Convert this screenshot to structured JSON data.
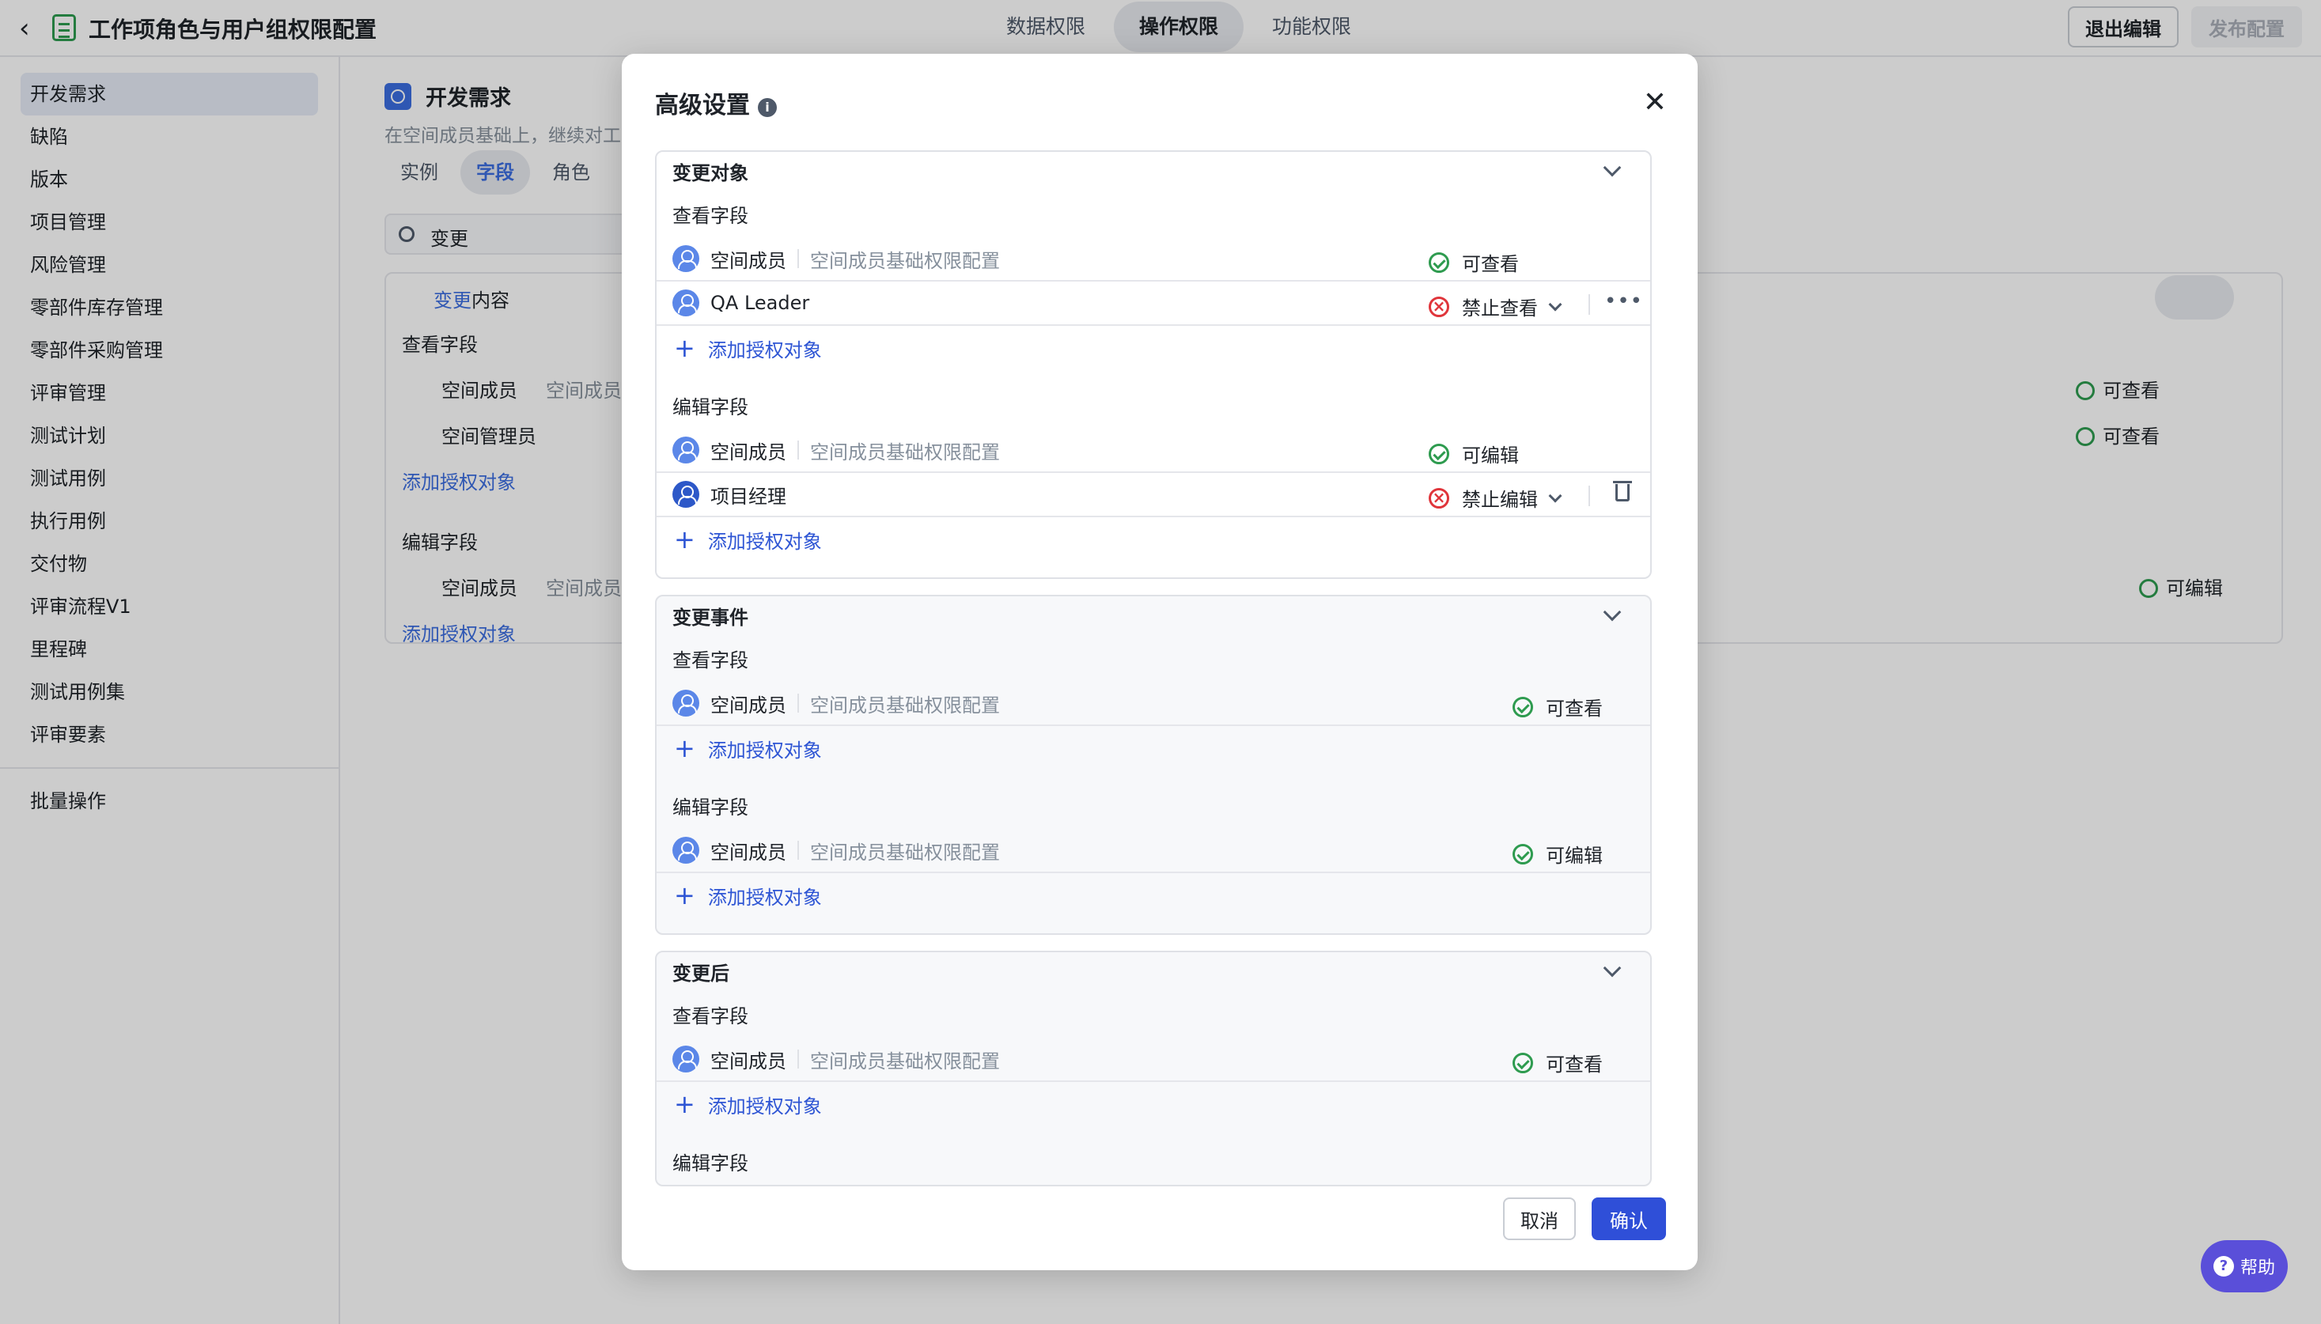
{
  "topbar": {
    "title": "工作项角色与用户组权限配置",
    "tabs": [
      {
        "label": "数据权限"
      },
      {
        "label": "操作权限"
      },
      {
        "label": "功能权限"
      }
    ],
    "exit_label": "退出编辑",
    "publish_label": "发布配置"
  },
  "sidebar": {
    "items": [
      {
        "label": "开发需求"
      },
      {
        "label": "缺陷"
      },
      {
        "label": "版本"
      },
      {
        "label": "项目管理"
      },
      {
        "label": "风险管理"
      },
      {
        "label": "零部件库存管理"
      },
      {
        "label": "零部件采购管理"
      },
      {
        "label": "评审管理"
      },
      {
        "label": "测试计划"
      },
      {
        "label": "测试用例"
      },
      {
        "label": "执行用例"
      },
      {
        "label": "交付物"
      },
      {
        "label": "评审流程V1"
      },
      {
        "label": "里程碑"
      },
      {
        "label": "测试用例集"
      },
      {
        "label": "评审要素"
      }
    ],
    "batch_label": "批量操作"
  },
  "background": {
    "header_title": "开发需求",
    "desc": "在空间成员基础上，继续对工",
    "tabs": [
      {
        "label": "实例"
      },
      {
        "label": "字段"
      },
      {
        "label": "角色"
      }
    ],
    "search_value": "变更",
    "card_title_blue": "变更",
    "card_title_rest": "内容",
    "view_group": "查看字段",
    "edit_group": "编辑字段",
    "member": "空间成员",
    "member_desc": "空间成员基",
    "admin": "空间管理员",
    "add": "添加授权对象",
    "can_view": "可查看",
    "can_edit": "可编辑"
  },
  "modal": {
    "title": "高级设置",
    "sections": [
      {
        "title": "变更对象",
        "view_title": "查看字段",
        "view_rows": [
          {
            "name": "空间成员",
            "desc": "空间成员基础权限配置",
            "perm": "可查看",
            "type": "allow"
          },
          {
            "name": "QA Leader",
            "desc": "",
            "perm": "禁止查看",
            "type": "deny"
          }
        ],
        "edit_title": "编辑字段",
        "edit_rows": [
          {
            "name": "空间成员",
            "desc": "空间成员基础权限配置",
            "perm": "可编辑",
            "type": "allow"
          },
          {
            "name": "项目经理",
            "desc": "",
            "perm": "禁止编辑",
            "type": "deny"
          }
        ]
      },
      {
        "title": "变更事件",
        "view_title": "查看字段",
        "view_rows": [
          {
            "name": "空间成员",
            "desc": "空间成员基础权限配置",
            "perm": "可查看",
            "type": "allow"
          }
        ],
        "edit_title": "编辑字段",
        "edit_rows": [
          {
            "name": "空间成员",
            "desc": "空间成员基础权限配置",
            "perm": "可编辑",
            "type": "allow"
          }
        ]
      },
      {
        "title": "变更后",
        "view_title": "查看字段",
        "view_rows": [
          {
            "name": "空间成员",
            "desc": "空间成员基础权限配置",
            "perm": "可查看",
            "type": "allow"
          }
        ],
        "edit_title": "编辑字段"
      }
    ],
    "add_label": "添加授权对象",
    "cancel_label": "取消",
    "confirm_label": "确认"
  },
  "help_label": "帮助"
}
